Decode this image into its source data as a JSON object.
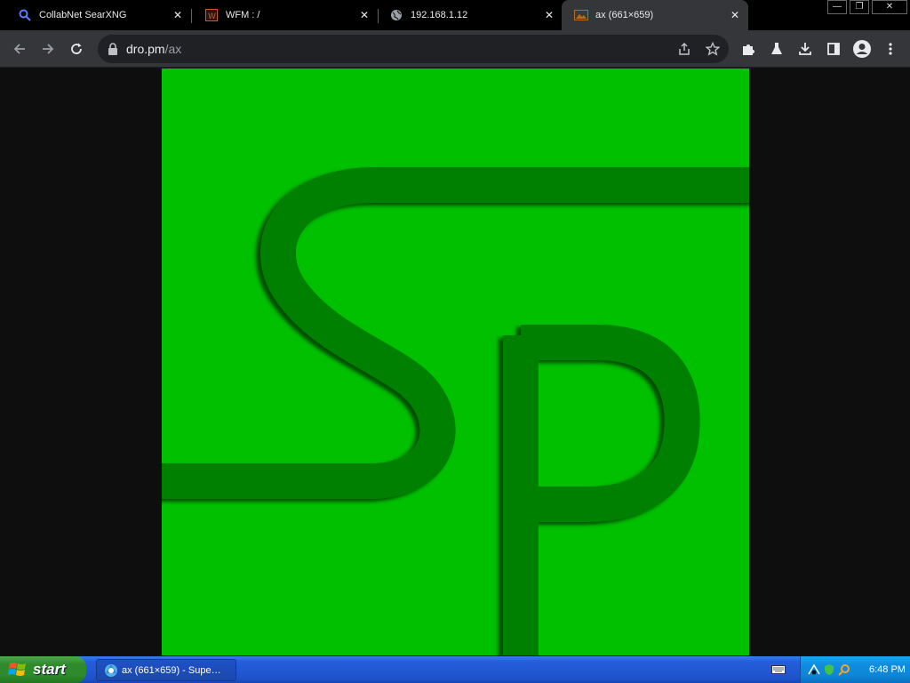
{
  "browser": {
    "tabs": [
      {
        "title": "CollabNet SearXNG",
        "icon": "search-icon",
        "close": "✕"
      },
      {
        "title": "WFM : /",
        "icon": "wfm-icon",
        "close": "✕"
      },
      {
        "title": "192.168.1.12",
        "icon": "globe-icon",
        "close": "✕"
      },
      {
        "title": "ax (661×659)",
        "icon": "image-icon",
        "close": "✕",
        "active": true
      }
    ],
    "window_controls": {
      "minimize": "—",
      "restore": "❐",
      "close": "✕"
    },
    "address": {
      "host": "dro.pm",
      "path": "/ax"
    },
    "colors": {
      "tabstrip": "#000000",
      "toolbar": "#35363a",
      "omnibox": "#202124"
    }
  },
  "content": {
    "image_background": "#00c000",
    "logo_color": "#008000",
    "logo_letters": "Sp"
  },
  "taskbar": {
    "start_label": "start",
    "task_label": "ax (661×659) - Supe…",
    "clock": "6:48 PM"
  }
}
